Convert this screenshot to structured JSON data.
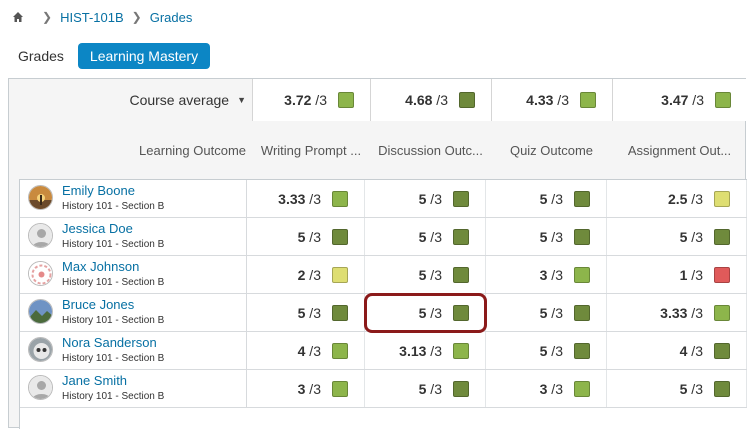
{
  "breadcrumb": {
    "course": "HIST-101B",
    "page": "Grades"
  },
  "tabs": [
    {
      "label": "Grades",
      "active": false
    },
    {
      "label": "Learning Mastery",
      "active": true
    }
  ],
  "colors": {
    "exceeds": "#6f8a3c",
    "mastery": "#8db54b",
    "near": "#dede72",
    "below": "#e05a5a",
    "link": "#0770a3",
    "active_tab": "#0c86c5"
  },
  "course_average": {
    "label": "Course average",
    "values": [
      {
        "score": "3.72",
        "suffix": " /3",
        "level": "mastery"
      },
      {
        "score": "4.68",
        "suffix": " /3",
        "level": "exceeds"
      },
      {
        "score": "4.33",
        "suffix": " /3",
        "level": "mastery"
      },
      {
        "score": "3.47",
        "suffix": " /3",
        "level": "mastery"
      }
    ]
  },
  "columns": {
    "label": "Learning Outcome",
    "outcomes": [
      "Writing Prompt ...",
      "Discussion Outc...",
      "Quiz Outcome",
      "Assignment Out..."
    ]
  },
  "students": [
    {
      "name": "Emily Boone",
      "section": "History 101 - Section B",
      "avatar": "sunset",
      "scores": [
        {
          "score": "3.33",
          "suffix": " /3",
          "level": "mastery"
        },
        {
          "score": "5",
          "suffix": " /3",
          "level": "exceeds"
        },
        {
          "score": "5",
          "suffix": " /3",
          "level": "exceeds"
        },
        {
          "score": "2.5",
          "suffix": " /3",
          "level": "near"
        }
      ]
    },
    {
      "name": "Jessica Doe",
      "section": "History 101 - Section B",
      "avatar": "default",
      "scores": [
        {
          "score": "5",
          "suffix": " /3",
          "level": "exceeds"
        },
        {
          "score": "5",
          "suffix": " /3",
          "level": "exceeds"
        },
        {
          "score": "5",
          "suffix": " /3",
          "level": "exceeds"
        },
        {
          "score": "5",
          "suffix": " /3",
          "level": "exceeds"
        }
      ]
    },
    {
      "name": "Max Johnson",
      "section": "History 101 - Section B",
      "avatar": "pattern",
      "scores": [
        {
          "score": "2",
          "suffix": " /3",
          "level": "near"
        },
        {
          "score": "5",
          "suffix": " /3",
          "level": "exceeds"
        },
        {
          "score": "3",
          "suffix": " /3",
          "level": "mastery"
        },
        {
          "score": "1",
          "suffix": " /3",
          "level": "below"
        }
      ]
    },
    {
      "name": "Bruce Jones",
      "section": "History 101 - Section B",
      "avatar": "landscape",
      "scores": [
        {
          "score": "5",
          "suffix": " /3",
          "level": "exceeds"
        },
        {
          "score": "5",
          "suffix": " /3",
          "level": "exceeds"
        },
        {
          "score": "5",
          "suffix": " /3",
          "level": "exceeds"
        },
        {
          "score": "3.33",
          "suffix": " /3",
          "level": "mastery"
        }
      ]
    },
    {
      "name": "Nora Sanderson",
      "section": "History 101 - Section B",
      "avatar": "animal",
      "scores": [
        {
          "score": "4",
          "suffix": " /3",
          "level": "mastery"
        },
        {
          "score": "3.13",
          "suffix": " /3",
          "level": "mastery"
        },
        {
          "score": "5",
          "suffix": " /3",
          "level": "exceeds"
        },
        {
          "score": "4",
          "suffix": " /3",
          "level": "exceeds"
        }
      ]
    },
    {
      "name": "Jane Smith",
      "section": "History 101 - Section B",
      "avatar": "default",
      "scores": [
        {
          "score": "3",
          "suffix": " /3",
          "level": "mastery"
        },
        {
          "score": "5",
          "suffix": " /3",
          "level": "exceeds"
        },
        {
          "score": "3",
          "suffix": " /3",
          "level": "mastery"
        },
        {
          "score": "5",
          "suffix": " /3",
          "level": "exceeds"
        }
      ]
    }
  ],
  "highlighted_cell": {
    "student": "Bruce Jones",
    "outcome": "Discussion Outc..."
  }
}
